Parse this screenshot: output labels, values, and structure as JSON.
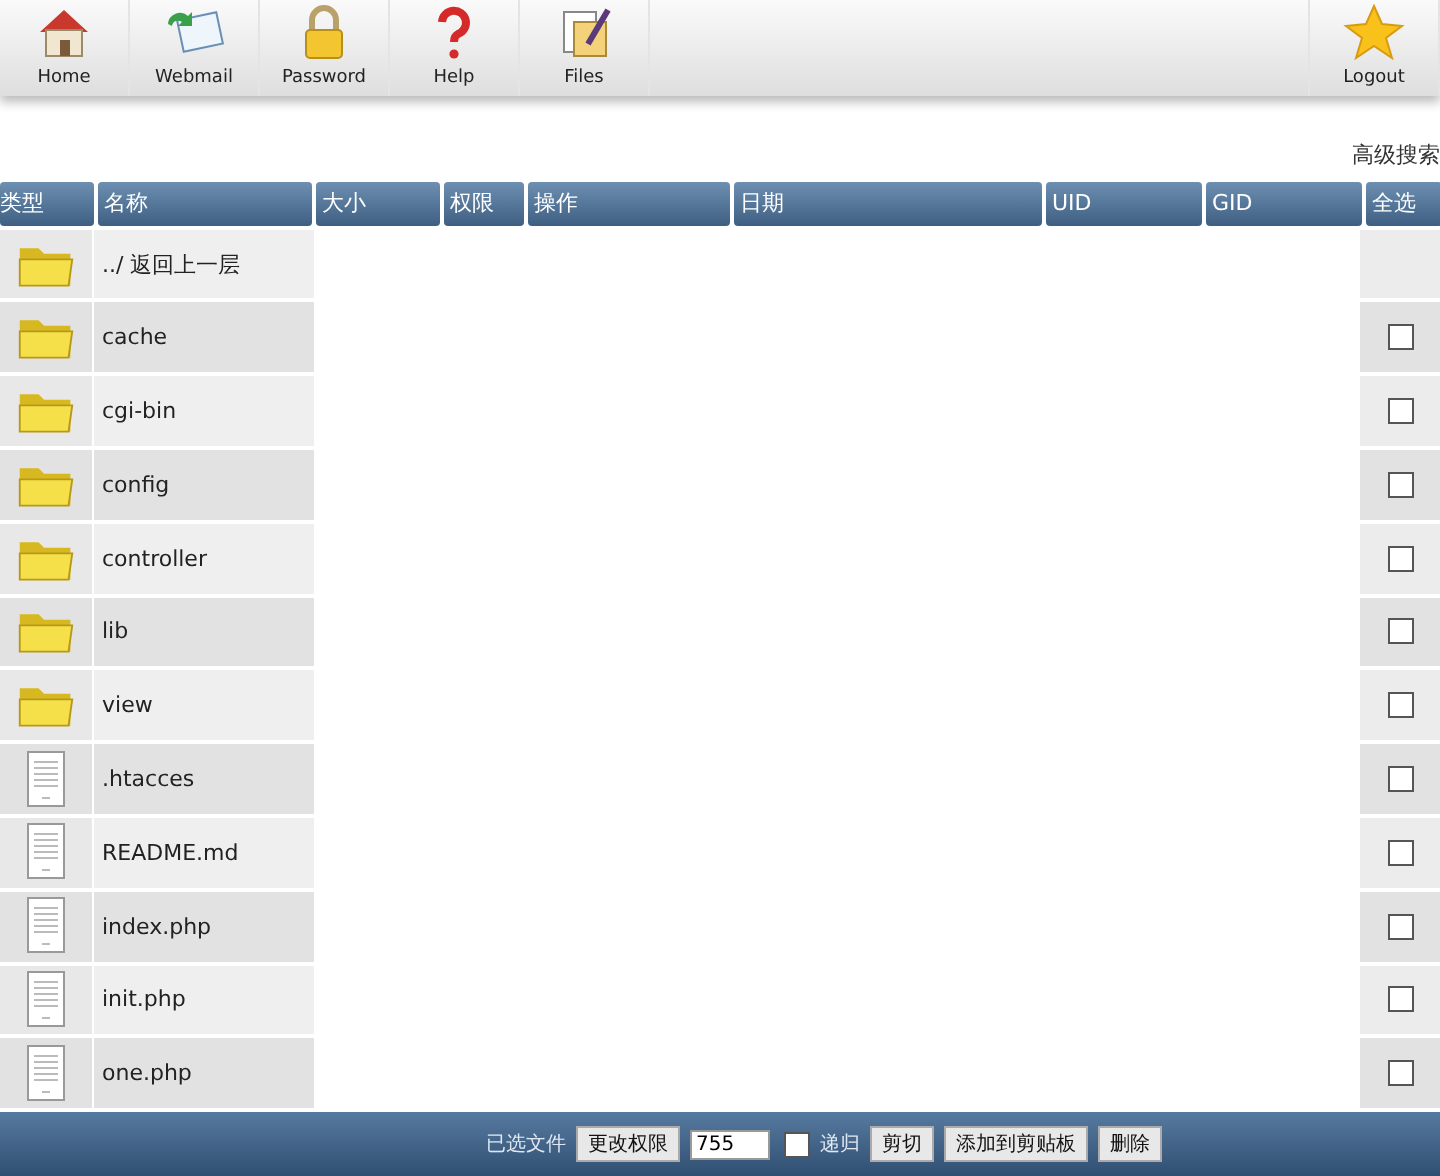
{
  "toolbar": [
    {
      "label": "Home",
      "kind": "home"
    },
    {
      "label": "Webmail",
      "kind": "mail"
    },
    {
      "label": "Password",
      "kind": "lock"
    },
    {
      "label": "Help",
      "kind": "help"
    },
    {
      "label": "Files",
      "kind": "files"
    }
  ],
  "logout": {
    "label": "Logout"
  },
  "advanced_search": "高级搜索",
  "table": {
    "columns": [
      "类型",
      "名称",
      "大小",
      "权限",
      "操作",
      "日期",
      "UID",
      "GID",
      "全选"
    ],
    "rows": [
      {
        "kind": "folder",
        "name": "../ 返回上一层"
      },
      {
        "kind": "folder",
        "name": "cache",
        "checked": false
      },
      {
        "kind": "folder",
        "name": "cgi-bin",
        "checked": false
      },
      {
        "kind": "folder",
        "name": "config",
        "checked": false
      },
      {
        "kind": "folder",
        "name": "controller",
        "checked": false
      },
      {
        "kind": "folder",
        "name": "lib",
        "checked": false
      },
      {
        "kind": "folder",
        "name": "view",
        "checked": false
      },
      {
        "kind": "file",
        "name": ".htacces",
        "checked": false
      },
      {
        "kind": "file",
        "name": "README.md",
        "checked": false
      },
      {
        "kind": "file",
        "name": "index.php",
        "checked": false
      },
      {
        "kind": "file",
        "name": "init.php",
        "checked": false
      },
      {
        "kind": "file",
        "name": "one.php",
        "checked": false
      }
    ]
  },
  "footer": {
    "selected_label": "已选文件",
    "chmod_button": "更改权限",
    "mode_value": "755",
    "recursive": {
      "label": "递归",
      "checked": false
    },
    "buttons": [
      "剪切",
      "添加到剪贴板",
      "删除"
    ]
  }
}
